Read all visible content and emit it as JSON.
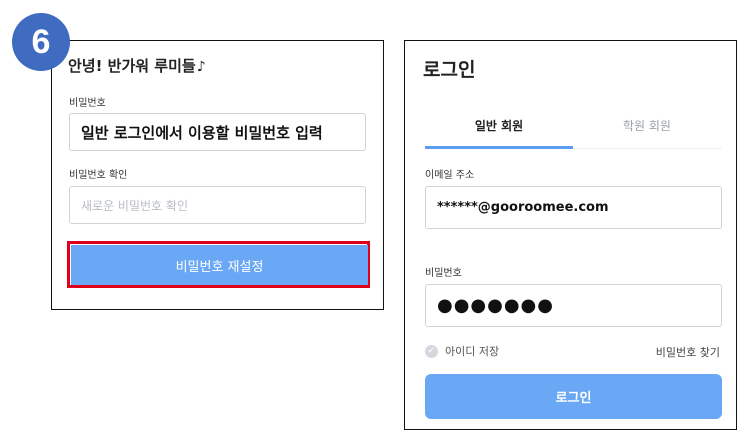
{
  "step_number": "6",
  "reset_panel": {
    "greeting": "안녕! 반가워 루미들",
    "greeting_note": "♪",
    "password_label": "비밀번호",
    "password_value": "일반 로그인에서 이용할 비밀번호 입력",
    "confirm_label": "비밀번호 확인",
    "confirm_placeholder": "새로운 비밀번호 확인",
    "reset_button": "비밀번호 재설정"
  },
  "login_panel": {
    "title": "로그인",
    "tabs": [
      {
        "label": "일반 회원",
        "active": true
      },
      {
        "label": "학원 회원",
        "active": false
      }
    ],
    "email_label": "이메일 주소",
    "email_value": "******@gooroomee.com",
    "password_label": "비밀번호",
    "password_value": "●●●●●●●",
    "save_id_label": "아이디 저장",
    "save_id_icon": "check-icon",
    "find_password": "비밀번호 찾기",
    "login_button": "로그인"
  },
  "colors": {
    "badge": "#3f6cc0",
    "button_blue": "#6aa8f5",
    "highlight_red": "#e0001b",
    "tab_underline": "#5b9df0"
  }
}
